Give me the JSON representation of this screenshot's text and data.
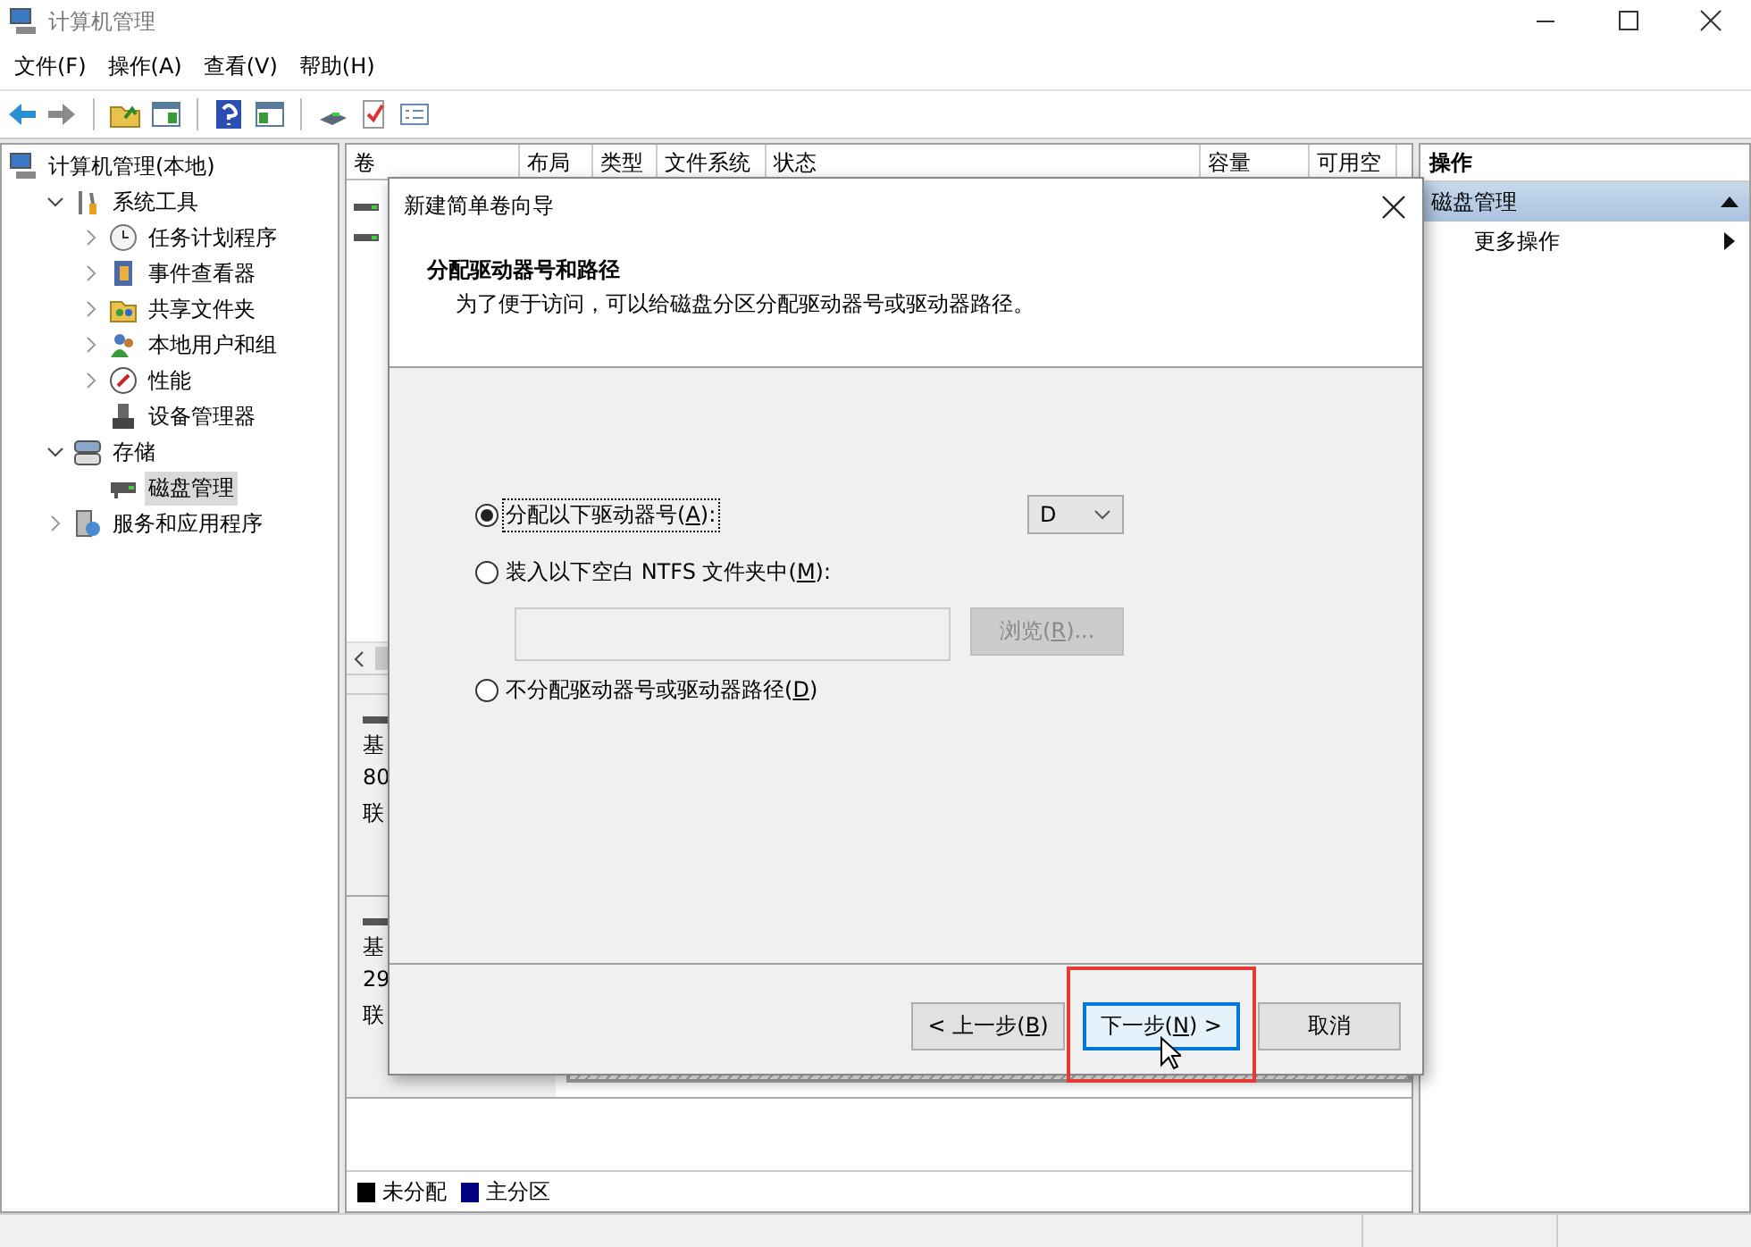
{
  "window": {
    "title": "计算机管理"
  },
  "menu": [
    "文件(F)",
    "操作(A)",
    "查看(V)",
    "帮助(H)"
  ],
  "tree": [
    {
      "label": "计算机管理(本地)",
      "selected": false,
      "children": [
        {
          "label": "系统工具",
          "expanded": true,
          "selected": false,
          "children": [
            {
              "label": "任务计划程序",
              "expanded": false,
              "selected": false
            },
            {
              "label": "事件查看器",
              "expanded": false,
              "selected": false
            },
            {
              "label": "共享文件夹",
              "expanded": false,
              "selected": false
            },
            {
              "label": "本地用户和组",
              "expanded": false,
              "selected": false
            },
            {
              "label": "性能",
              "expanded": false,
              "selected": false
            },
            {
              "label": "设备管理器",
              "selected": false
            }
          ]
        },
        {
          "label": "存储",
          "expanded": true,
          "selected": false,
          "children": [
            {
              "label": "磁盘管理",
              "selected": true
            }
          ]
        },
        {
          "label": "服务和应用程序",
          "expanded": false,
          "selected": false
        }
      ]
    }
  ],
  "volume_table": {
    "columns": [
      "卷",
      "布局",
      "类型",
      "文件系统",
      "状态",
      "容量",
      "可用空"
    ]
  },
  "disks": [
    {
      "lines": [
        "基",
        "80",
        "联"
      ]
    },
    {
      "lines": [
        "基",
        "29",
        "联"
      ]
    }
  ],
  "legend": [
    {
      "label": "未分配",
      "color": "#000000"
    },
    {
      "label": "主分区",
      "color": "#000080"
    }
  ],
  "actions": {
    "header": "操作",
    "section": {
      "label": "磁盘管理",
      "expanded": true
    },
    "items": [
      "更多操作"
    ]
  },
  "dialog": {
    "title": "新建简单卷向导",
    "heading": "分配驱动器号和路径",
    "description": "为了便于访问，可以给磁盘分区分配驱动器号或驱动器路径。",
    "options": [
      {
        "kind": "letter",
        "before": "分配以下驱动器号(",
        "key": "A",
        "after": "):",
        "selected": true,
        "drive_letter": "D"
      },
      {
        "kind": "folder",
        "before": "装入以下空白 NTFS 文件夹中(",
        "key": "M",
        "after": "):",
        "selected": false,
        "browse": {
          "before": "浏览(",
          "key": "R",
          "after": ")...",
          "disabled": true
        }
      },
      {
        "kind": "none",
        "before": "不分配驱动器号或驱动器路径(",
        "key": "D",
        "after": ")",
        "selected": false
      }
    ],
    "buttons": [
      {
        "before": "< 上一步(",
        "key": "B",
        "after": ")",
        "focused": false,
        "highlighted": false
      },
      {
        "before": "下一步(",
        "key": "N",
        "after": ") >",
        "focused": true,
        "highlighted": true
      },
      {
        "before": "取消",
        "focused": false,
        "highlighted": false
      }
    ]
  }
}
